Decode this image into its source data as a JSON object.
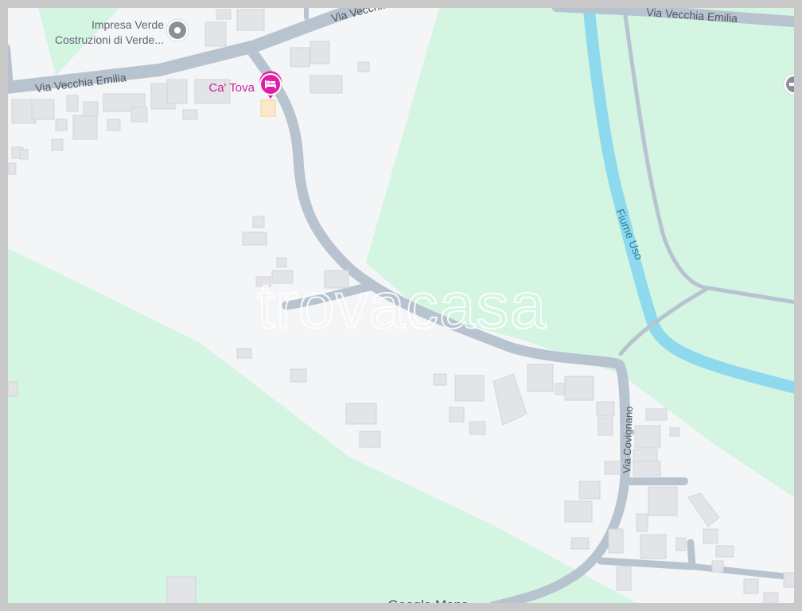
{
  "colors": {
    "frame": "#c9c9c9",
    "land": "#f4f5f7",
    "park": "#d3f5e2",
    "road": "#b7c2cf",
    "road_edge": "#a9b5c3",
    "river": "#8fd9ee",
    "building": "#e4e6ea",
    "building_edge": "#d5d8dd",
    "label_text": "#5f6670",
    "river_label": "#2f7e98",
    "poi_gray": "#8a9099",
    "poi_pink": "#e01ea4",
    "highlight": "#fce8c6"
  },
  "labels": {
    "road_top_left": "Via Vecchia Emilia",
    "road_top_mid": "Via Vecchia Emilia",
    "road_top_right": "Via Vecchia Emilia",
    "road_covignano": "Via Covignano",
    "river": "Fiume Uso",
    "poi_impresa_line1": "Impresa Verde",
    "poi_impresa_line2": "Costruzioni di Verde...",
    "poi_hotel": "Ca' Tova",
    "watermark": "trovacasa",
    "attribution": "Google Maps"
  },
  "icons": {
    "impresa": "location-pin-icon",
    "hotel": "bed-icon",
    "edge_poi": "place-pin-icon"
  }
}
